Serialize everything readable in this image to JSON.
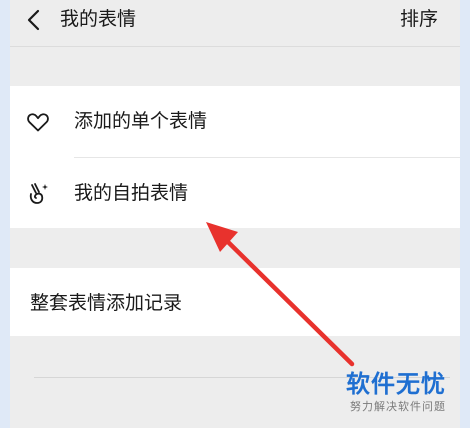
{
  "header": {
    "title": "我的表情",
    "sort_label": "排序",
    "back_icon": "chevron-left-icon"
  },
  "list": {
    "items": [
      {
        "label": "添加的单个表情",
        "icon": "heart-outline-icon"
      },
      {
        "label": "我的自拍表情",
        "icon": "selfie-hand-sparkle-icon"
      }
    ]
  },
  "list2": {
    "items": [
      {
        "label": "整套表情添加记录"
      }
    ]
  },
  "watermark": {
    "title": "软件无忧",
    "subtitle": "努力解决软件问题"
  },
  "colors": {
    "background": "#ededed",
    "card": "#ffffff",
    "arrow": "#e8322d",
    "watermark": "#1f6fd1"
  }
}
